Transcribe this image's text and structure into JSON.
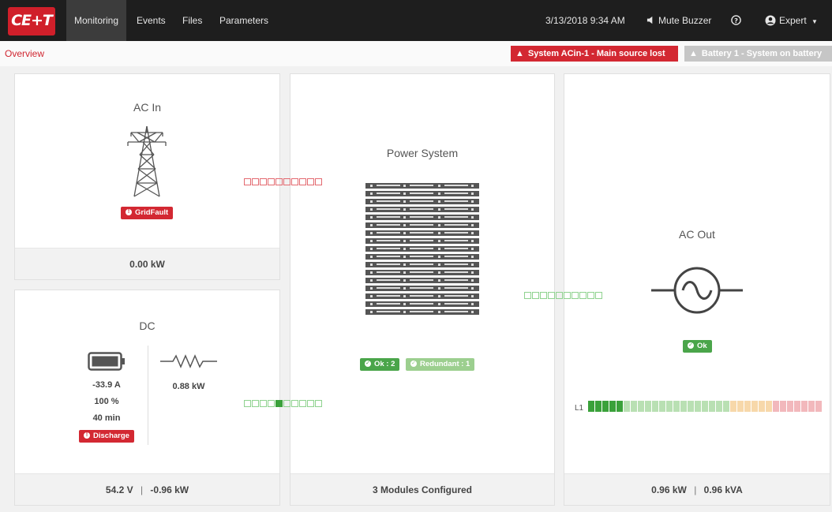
{
  "header": {
    "logo_text": "CE+T",
    "nav": [
      {
        "label": "Monitoring",
        "active": true
      },
      {
        "label": "Events",
        "active": false
      },
      {
        "label": "Files",
        "active": false
      },
      {
        "label": "Parameters",
        "active": false
      }
    ],
    "datetime": "3/13/2018 9:34 AM",
    "mute_label": "Mute Buzzer",
    "user_label": "Expert"
  },
  "subbar": {
    "breadcrumb": "Overview",
    "alarms": [
      {
        "text": "System ACin-1 - Main source lost",
        "severity": "major"
      },
      {
        "text": "Battery 1 - System on battery",
        "severity": "inactive"
      }
    ]
  },
  "ac_in": {
    "title": "AC In",
    "status": "GridFault",
    "footer": "0.00 kW"
  },
  "dc": {
    "title": "DC",
    "battery_current": "-33.9 A",
    "battery_soc": "100 %",
    "battery_time": "40 min",
    "battery_status": "Discharge",
    "load_power": "0.88 kW",
    "footer_voltage": "54.2 V",
    "footer_separator": "|",
    "footer_power": "-0.96 kW"
  },
  "power_system": {
    "title": "Power System",
    "ok_badge": "Ok : 2",
    "redundant_badge": "Redundant : 1",
    "footer": "3 Modules Configured",
    "module_rows": 17
  },
  "ac_out": {
    "title": "AC Out",
    "status": "Ok",
    "phase_label": "L1",
    "phase_load_fraction": 0.16,
    "footer_power": "0.96 kW",
    "footer_separator": "|",
    "footer_apparent": "0.96 kVA"
  },
  "flows": {
    "acin_to_system": {
      "count": 10,
      "active": 0,
      "state": "fault"
    },
    "dc_to_system": {
      "count": 10,
      "active_index": 4,
      "state": "ok"
    },
    "system_to_acout": {
      "count": 10,
      "active": 0,
      "state": "ok"
    }
  },
  "colors": {
    "brand_red": "#d01f2a",
    "alarm_red": "#d32832",
    "ok_green": "#4aa54a",
    "light_green": "#9ccf8f",
    "topbar": "#1e1e1e"
  },
  "icons": {
    "mute": "speaker-icon",
    "help": "help-circle-icon",
    "user": "user-circle-icon",
    "ac_in": "power-pylon-icon",
    "dc_battery": "battery-icon",
    "dc_load": "resistor-icon",
    "ac_out": "sine-wave-icon"
  }
}
